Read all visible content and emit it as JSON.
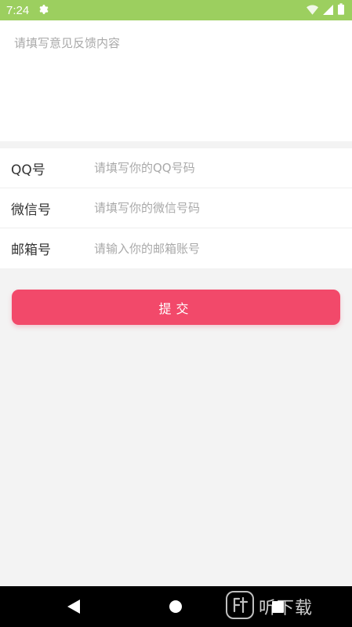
{
  "status_bar": {
    "time": "7:24",
    "icons": [
      "gear-icon",
      "wifi-icon",
      "signal-icon",
      "battery-icon"
    ]
  },
  "feedback": {
    "placeholder": "请填写意见反馈内容",
    "value": ""
  },
  "form": {
    "qq": {
      "label": "QQ号",
      "placeholder": "请填写你的QQ号码",
      "value": ""
    },
    "wechat": {
      "label": "微信号",
      "placeholder": "请填写你的微信号码",
      "value": ""
    },
    "email": {
      "label": "邮箱号",
      "placeholder": "请输入你的邮箱账号",
      "value": ""
    }
  },
  "submit": {
    "label": "提交"
  },
  "navigation": {
    "icons": [
      "back-icon",
      "home-icon",
      "recent-apps-icon"
    ]
  },
  "watermark": {
    "text": "听下载"
  },
  "colors": {
    "status_bar": "#9ccf5f",
    "accent": "#f2496a",
    "background": "#f3f3f3",
    "nav_bar": "#000000"
  }
}
